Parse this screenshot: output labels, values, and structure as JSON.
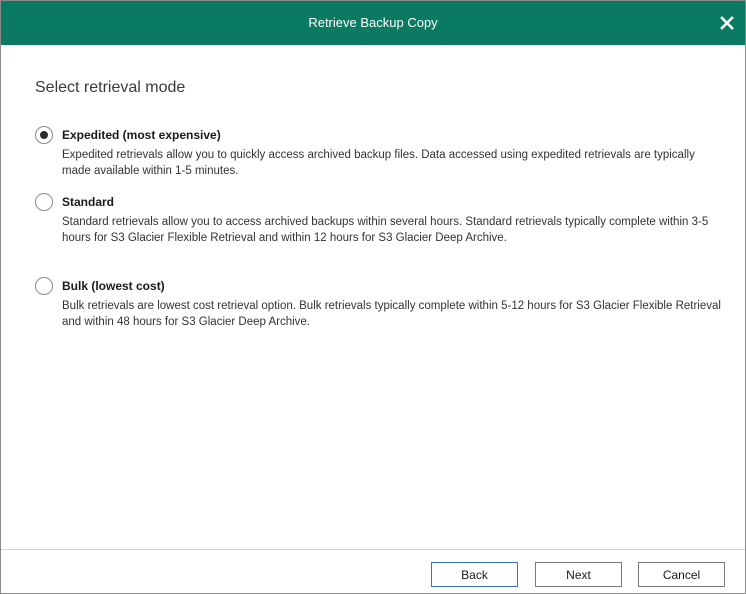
{
  "window": {
    "title": "Retrieve Backup Copy",
    "close_icon": "close-icon"
  },
  "heading": "Select retrieval mode",
  "options": [
    {
      "label": "Expedited (most expensive)",
      "description": "Expedited retrievals allow you to quickly access archived backup files. Data accessed using expedited retrievals are typically made available within 1-5 minutes.",
      "selected": true
    },
    {
      "label": "Standard",
      "description": "Standard retrievals allow you to access archived backups within several hours. Standard retrievals typically complete within 3-5 hours for S3 Glacier Flexible Retrieval and within 12 hours for S3 Glacier Deep Archive.",
      "selected": false
    },
    {
      "label": "Bulk (lowest cost)",
      "description": "Bulk retrievals are lowest cost retrieval option. Bulk retrievals typically complete within 5-12 hours for S3 Glacier Flexible Retrieval and within 48 hours for S3 Glacier Deep Archive.",
      "selected": false
    }
  ],
  "buttons": {
    "back": "Back",
    "next": "Next",
    "cancel": "Cancel"
  },
  "colors": {
    "titlebar": "#0b7a63",
    "title_text": "#ffffff"
  }
}
